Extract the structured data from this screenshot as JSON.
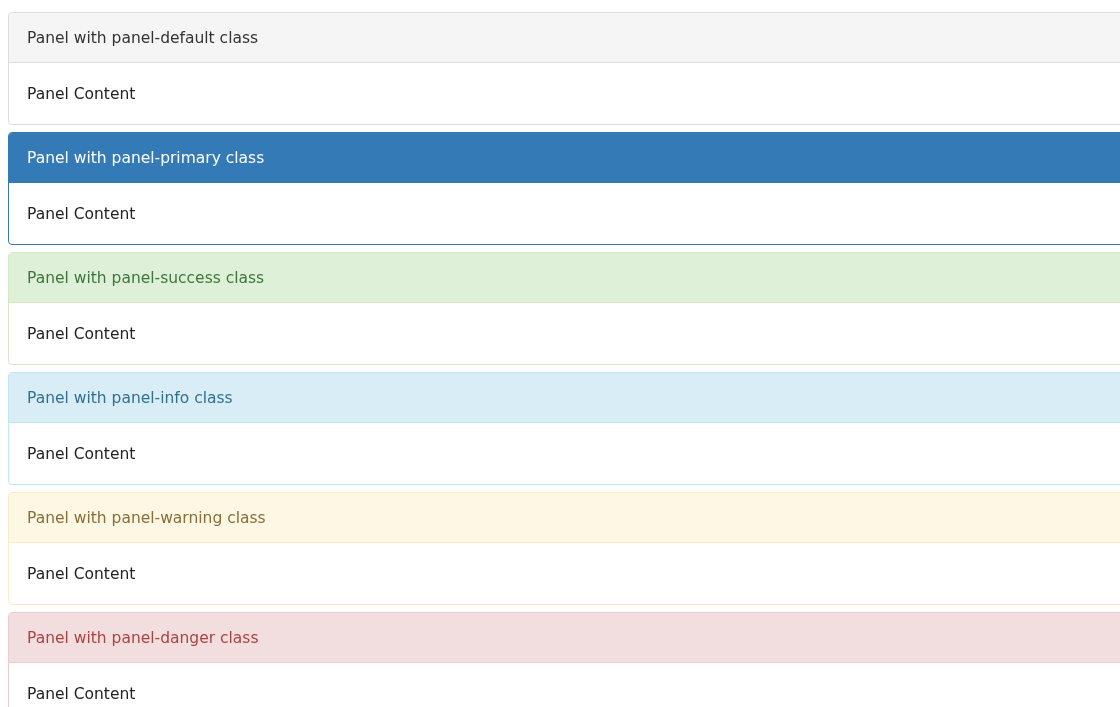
{
  "panels": [
    {
      "kind": "default",
      "title": "Panel with panel-default class",
      "content": "Panel Content"
    },
    {
      "kind": "primary",
      "title": "Panel with panel-primary class",
      "content": "Panel Content"
    },
    {
      "kind": "success",
      "title": "Panel with panel-success class",
      "content": "Panel Content"
    },
    {
      "kind": "info",
      "title": "Panel with panel-info class",
      "content": "Panel Content"
    },
    {
      "kind": "warning",
      "title": "Panel with panel-warning class",
      "content": "Panel Content"
    },
    {
      "kind": "danger",
      "title": "Panel with panel-danger class",
      "content": "Panel Content"
    }
  ]
}
